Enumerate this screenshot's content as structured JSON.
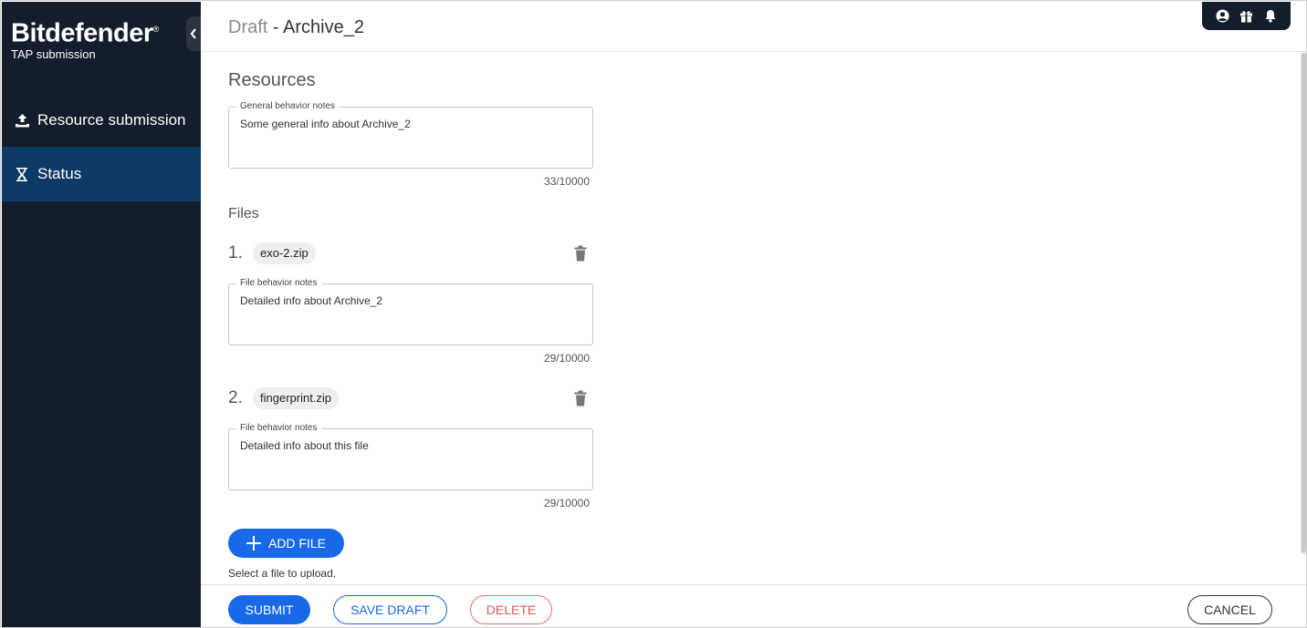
{
  "sidebar": {
    "brand": "Bitdefender",
    "brand_mark": "®",
    "subtitle": "TAP submission",
    "items": [
      {
        "label": "Resource submission",
        "icon": "upload-icon",
        "active": false
      },
      {
        "label": "Status",
        "icon": "hourglass-icon",
        "active": true
      }
    ]
  },
  "header": {
    "draft_label": "Draft",
    "separator": " - ",
    "title": "Archive_2",
    "icons": [
      "account-icon",
      "gift-icon",
      "bell-icon"
    ]
  },
  "main": {
    "section_title": "Resources",
    "general_notes": {
      "label": "General behavior notes",
      "value": "Some general info about Archive_2",
      "counter": "33/10000"
    },
    "files_title": "Files",
    "files": [
      {
        "number": "1.",
        "name": "exo-2.zip",
        "notes_label": "File behavior notes",
        "notes": "Detailed info about Archive_2",
        "counter": "29/10000"
      },
      {
        "number": "2.",
        "name": "fingerprint.zip",
        "notes_label": "File behavior notes",
        "notes": "Detailed info about this file",
        "counter": "29/10000"
      }
    ],
    "add_file_label": "ADD FILE",
    "helper_text": "Select a file to upload."
  },
  "footer": {
    "submit": "SUBMIT",
    "save_draft": "SAVE DRAFT",
    "delete": "DELETE",
    "cancel": "CANCEL"
  },
  "colors": {
    "sidebar_bg": "#131d2b",
    "active_nav": "#0e3a66",
    "primary": "#1769e8",
    "danger": "#e05a5a"
  }
}
